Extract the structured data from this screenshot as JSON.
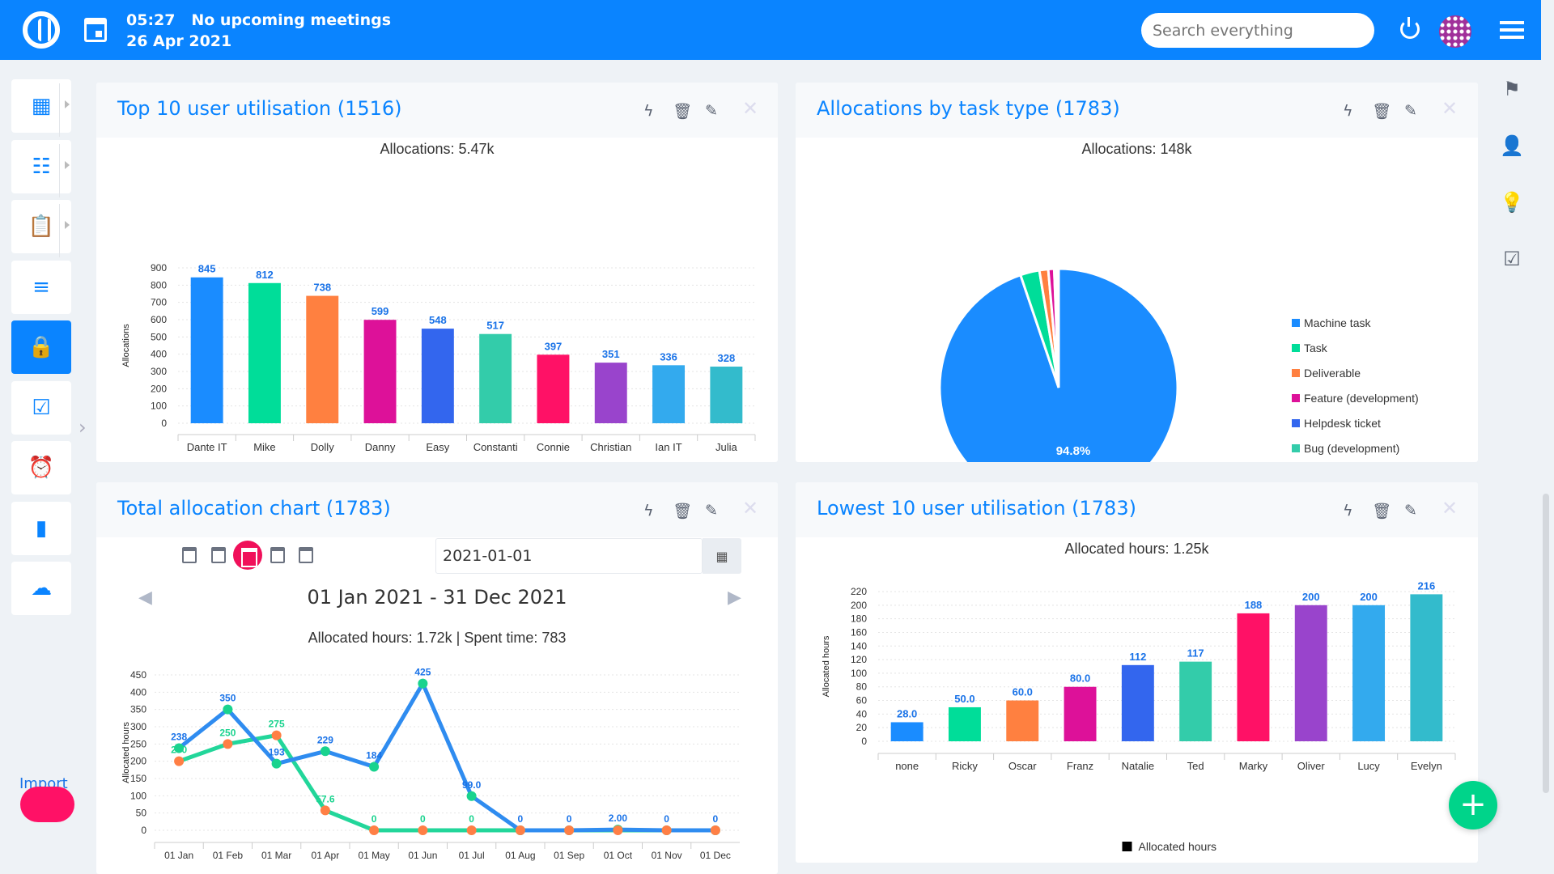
{
  "header": {
    "time": "05:27",
    "meeting": "No upcoming meetings",
    "date": "26 Apr 2021",
    "search_placeholder": "Search everything"
  },
  "sidebar": {
    "items": [
      {
        "icon": "dashboard-icon",
        "glyph": "▦"
      },
      {
        "icon": "project-tree-icon",
        "glyph": "☷"
      },
      {
        "icon": "clipboard-icon",
        "glyph": "📋"
      },
      {
        "icon": "task-list-icon",
        "glyph": "≡"
      },
      {
        "icon": "lock-icon",
        "glyph": "🔒",
        "active": true
      },
      {
        "icon": "clipboard-check-icon",
        "glyph": "☑"
      },
      {
        "icon": "alarm-add-icon",
        "glyph": "⏰"
      },
      {
        "icon": "bar-chart-icon",
        "glyph": "▮"
      },
      {
        "icon": "cloud-icon",
        "glyph": "☁"
      }
    ],
    "import_label": "Import"
  },
  "right_sidebar": [
    {
      "icon": "flag-icon",
      "glyph": "⚑"
    },
    {
      "icon": "user-search-icon",
      "glyph": "👤"
    },
    {
      "icon": "lightbulb-icon",
      "glyph": "💡"
    },
    {
      "icon": "checklist-icon",
      "glyph": "☑"
    }
  ],
  "panels": {
    "top_users": {
      "title": "Top 10 user utilisation (1516)",
      "subtitle": "Allocations: 5.47k"
    },
    "task_types": {
      "title": "Allocations by task type (1783)",
      "subtitle": "Allocations: 148k"
    },
    "total_alloc": {
      "title": "Total allocation chart (1783)",
      "date_value": "2021-01-01",
      "range": "01 Jan 2021 - 31 Dec 2021",
      "subtitle": "Allocated hours: 1.72k | Spent time: 783"
    },
    "lowest_users": {
      "title": "Lowest 10 user utilisation (1783)",
      "subtitle": "Allocated hours: 1.25k"
    }
  },
  "chart_data": [
    {
      "type": "bar",
      "title": "",
      "ylabel": "Allocations",
      "ylim": [
        0,
        900
      ],
      "yticks": [
        0,
        100,
        200,
        300,
        400,
        500,
        600,
        700,
        800,
        900
      ],
      "categories": [
        "Dante IT",
        "Mike",
        "Dolly",
        "Danny",
        "Easy",
        "Constanti",
        "Connie",
        "Christian",
        "Ian IT",
        "Julia"
      ],
      "values": [
        845,
        812,
        738,
        599,
        548,
        517,
        397,
        351,
        336,
        328
      ],
      "labels": [
        "845",
        "812",
        "738",
        "599",
        "548",
        "517",
        "397",
        "351",
        "336",
        "328"
      ],
      "colors": [
        "#1a8cff",
        "#00dd99",
        "#ff8040",
        "#dd1199",
        "#3366ee",
        "#33ccaa",
        "#ff1166",
        "#9944cc",
        "#33aaee",
        "#33bbcc"
      ],
      "legend": "Allocations"
    },
    {
      "type": "pie",
      "categories": [
        "Machine task",
        "Task",
        "Deliverable",
        "Feature (development)",
        "Helpdesk ticket",
        "Bug (development)"
      ],
      "values": [
        94.8,
        2.6,
        1.2,
        0.8,
        0.3,
        0.3
      ],
      "data_label": "94.8%",
      "colors": [
        "#1a8cff",
        "#00dd99",
        "#ff8040",
        "#dd1199",
        "#3366ee",
        "#33ccaa"
      ],
      "legend_position": "right"
    },
    {
      "type": "line",
      "ylabel": "Allocated hours",
      "ylim": [
        0,
        450
      ],
      "yticks": [
        0,
        50,
        100,
        150,
        200,
        250,
        300,
        350,
        400,
        450
      ],
      "categories": [
        "01 Jan",
        "01 Feb",
        "01 Mar",
        "01 Apr",
        "01 May",
        "01 Jun",
        "01 Jul",
        "01 Aug",
        "01 Sep",
        "01 Oct",
        "01 Nov",
        "01 Dec"
      ],
      "series": [
        {
          "values": [
            238,
            350,
            193,
            229,
            184,
            425,
            99,
            0,
            0,
            2,
            0,
            0
          ],
          "labels": [
            "238",
            "350",
            "193",
            "229",
            "184",
            "425",
            "99.0",
            "0",
            "0",
            "2.00",
            "0",
            "0"
          ],
          "color": "#2f8cf0",
          "marker": "#19d38e",
          "label_color": "#1a73e8"
        },
        {
          "values": [
            200,
            250,
            275,
            57.6,
            0,
            0,
            0,
            0,
            0,
            0,
            0,
            0
          ],
          "labels": [
            "200",
            "250",
            "275",
            "57.6",
            "0",
            "0",
            "0",
            "",
            "",
            "",
            "",
            ""
          ],
          "color": "#22d69a",
          "marker": "#ff7f45",
          "label_color": "#19d38e"
        }
      ]
    },
    {
      "type": "bar",
      "ylabel": "Allocated hours",
      "ylim": [
        0,
        220
      ],
      "yticks": [
        0,
        20,
        40,
        60,
        80,
        100,
        120,
        140,
        160,
        180,
        200,
        220
      ],
      "categories": [
        "none",
        "Ricky",
        "Oscar",
        "Franz",
        "Natalie",
        "Ted",
        "Marky",
        "Oliver",
        "Lucy",
        "Evelyn"
      ],
      "values": [
        28,
        50,
        60,
        80,
        112,
        117,
        188,
        200,
        200,
        216
      ],
      "labels": [
        "28.0",
        "50.0",
        "60.0",
        "80.0",
        "112",
        "117",
        "188",
        "200",
        "200",
        "216"
      ],
      "colors": [
        "#1a8cff",
        "#00dd99",
        "#ff8040",
        "#dd1199",
        "#3366ee",
        "#33ccaa",
        "#ff1166",
        "#9944cc",
        "#33aaee",
        "#33bbcc"
      ],
      "legend": "Allocated hours"
    }
  ]
}
